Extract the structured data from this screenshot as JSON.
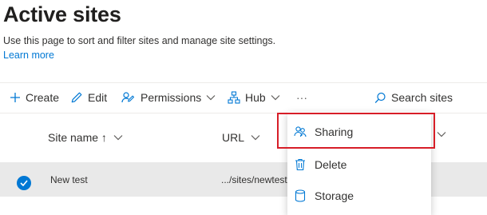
{
  "page": {
    "title": "Active sites",
    "description": "Use this page to sort and filter sites and manage site settings.",
    "learn_more": "Learn more"
  },
  "toolbar": {
    "create": "Create",
    "edit": "Edit",
    "permissions": "Permissions",
    "hub": "Hub",
    "more": "···",
    "search": "Search sites"
  },
  "columns": {
    "site_name": "Site name ↑",
    "url": "URL"
  },
  "rows": [
    {
      "site_name": "New test",
      "url": ".../sites/newtest"
    }
  ],
  "dropdown": {
    "items": [
      {
        "label": "Sharing",
        "icon": "people-icon"
      },
      {
        "label": "Delete",
        "icon": "trash-icon"
      },
      {
        "label": "Storage",
        "icon": "database-icon"
      }
    ]
  },
  "colors": {
    "accent": "#0078d4",
    "highlight_border": "#d71e28",
    "selected_row": "#e9e9e9"
  }
}
